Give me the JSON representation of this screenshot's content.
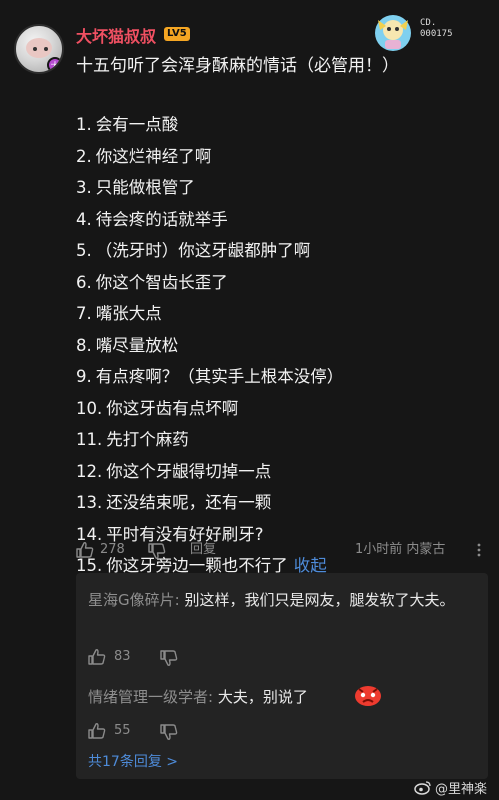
{
  "comment": {
    "username": "大坏猫叔叔",
    "level": "LV5",
    "deco_code_1": "CD.",
    "deco_code_2": "000175",
    "title": "十五句听了会浑身酥麻的情话（必管用！）",
    "lines": [
      {
        "num": "1.",
        "text": "会有一点酸"
      },
      {
        "num": "2.",
        "text": "你这烂神经了啊"
      },
      {
        "num": "3.",
        "text": "只能做根管了"
      },
      {
        "num": "4.",
        "text": "待会疼的话就举手"
      },
      {
        "num": "5.",
        "text": "（洗牙时）你这牙龈都肿了啊"
      },
      {
        "num": "6.",
        "text": "你这个智齿长歪了"
      },
      {
        "num": "7.",
        "text": "嘴张大点"
      },
      {
        "num": "8.",
        "text": "嘴尽量放松"
      },
      {
        "num": "9.",
        "text": "有点疼啊？（其实手上根本没停）"
      },
      {
        "num": "10.",
        "text": "你这牙齿有点坏啊"
      },
      {
        "num": "11.",
        "text": "先打个麻药"
      },
      {
        "num": "12.",
        "text": "你这个牙龈得切掉一点"
      },
      {
        "num": "13.",
        "text": "还没结束呢，还有一颗"
      },
      {
        "num": "14.",
        "text": "平时有没有好好刷牙?"
      },
      {
        "num": "15.",
        "text": "你这牙旁边一颗也不行了"
      }
    ],
    "collapse_label": "收起",
    "likes": "278",
    "reply_label": "回复",
    "meta": "1小时前 内蒙古"
  },
  "replies": [
    {
      "author": "星海G像碎片",
      "text": "别这样，我们只是网友，腿发软了大夫。",
      "likes": "83"
    },
    {
      "author": "情绪管理一级学者",
      "text": "大夫，别说了",
      "likes": "55"
    }
  ],
  "more_replies": "共17条回复 >",
  "watermark": "@里神楽",
  "icons": {
    "like": "thumbs-up-icon",
    "dislike": "thumbs-down-icon",
    "more": "more-dots-icon",
    "weibo": "weibo-logo-icon"
  }
}
